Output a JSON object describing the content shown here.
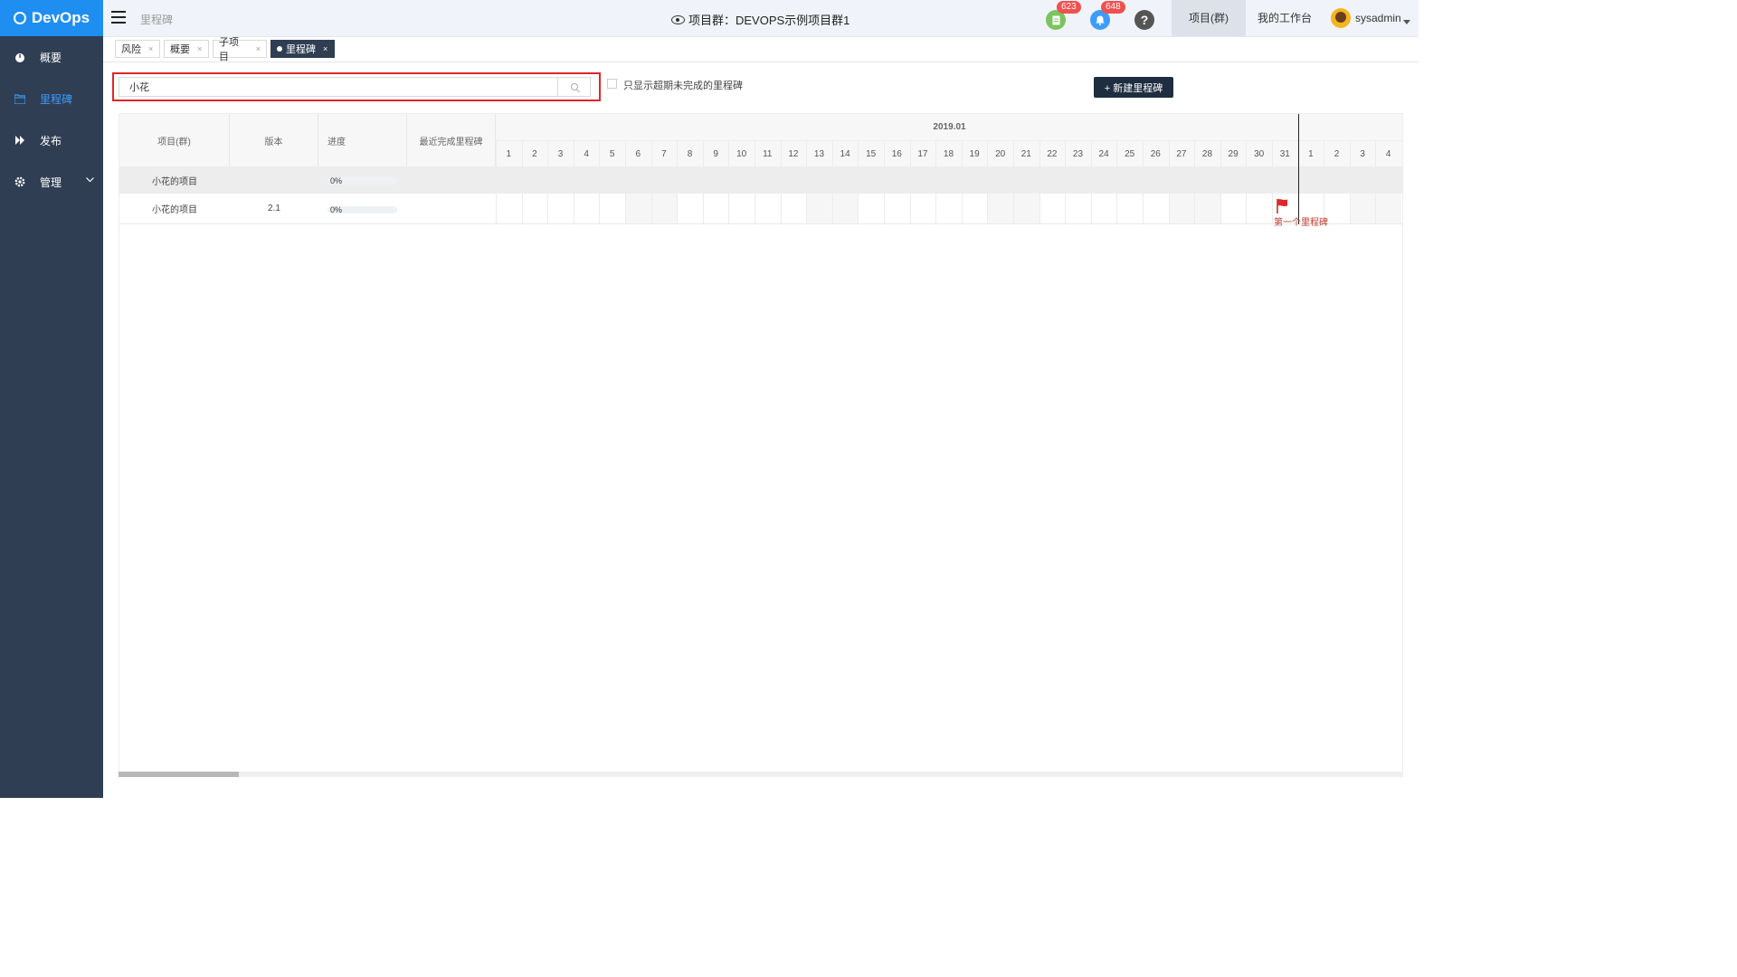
{
  "brand": {
    "name": "DevOps"
  },
  "sidebar": {
    "items": [
      {
        "label": "概要",
        "icon": "dashboard-icon"
      },
      {
        "label": "里程碑",
        "icon": "folder-icon"
      },
      {
        "label": "发布",
        "icon": "forward-icon"
      },
      {
        "label": "管理",
        "icon": "gear-icon"
      }
    ]
  },
  "topbar": {
    "breadcrumb": "里程碑",
    "title": "项目群：DEVOPS示例项目群1",
    "todo_badge": "623",
    "notify_badge": "648",
    "help_glyph": "?",
    "nav": [
      "项目(群)",
      "我的工作台"
    ],
    "user": "sysadmin"
  },
  "tabs": [
    {
      "label": "风险",
      "close": "×"
    },
    {
      "label": "概要",
      "close": "×"
    },
    {
      "label": "子项目",
      "close": "×"
    },
    {
      "label": "里程碑",
      "close": "×"
    }
  ],
  "toolbar": {
    "search_value": "小花",
    "checkbox_label": "只显示超期未完成的里程碑",
    "new_button": "+ 新建里程碑"
  },
  "grid": {
    "headers": [
      "项目(群)",
      "版本",
      "进度",
      "最近完成里程碑"
    ],
    "month": "2019.01",
    "days": [
      "1",
      "2",
      "3",
      "4",
      "5",
      "6",
      "7",
      "8",
      "9",
      "10",
      "11",
      "12",
      "13",
      "14",
      "15",
      "16",
      "17",
      "18",
      "19",
      "20",
      "21",
      "22",
      "23",
      "24",
      "25",
      "26",
      "27",
      "28",
      "29",
      "30",
      "31",
      "1",
      "2",
      "3",
      "4"
    ],
    "weekend_days": [
      5,
      6,
      12,
      13,
      19,
      20,
      26,
      27,
      33,
      34
    ],
    "rows": [
      {
        "project": "小花的项目",
        "version": "",
        "progress": "0%",
        "latest": ""
      },
      {
        "project": "小花的项目",
        "version": "2.1",
        "progress": "0%",
        "latest": ""
      }
    ],
    "milestone": {
      "label": "第一个里程碑",
      "day_index": 30
    },
    "today_day_index": 31
  },
  "colors": {
    "sidebar": "#2f3e53",
    "brand": "#1f8ef1",
    "accent_active": "#3d9cff",
    "highlight": "#e0262b",
    "flag": "#c0392b"
  }
}
